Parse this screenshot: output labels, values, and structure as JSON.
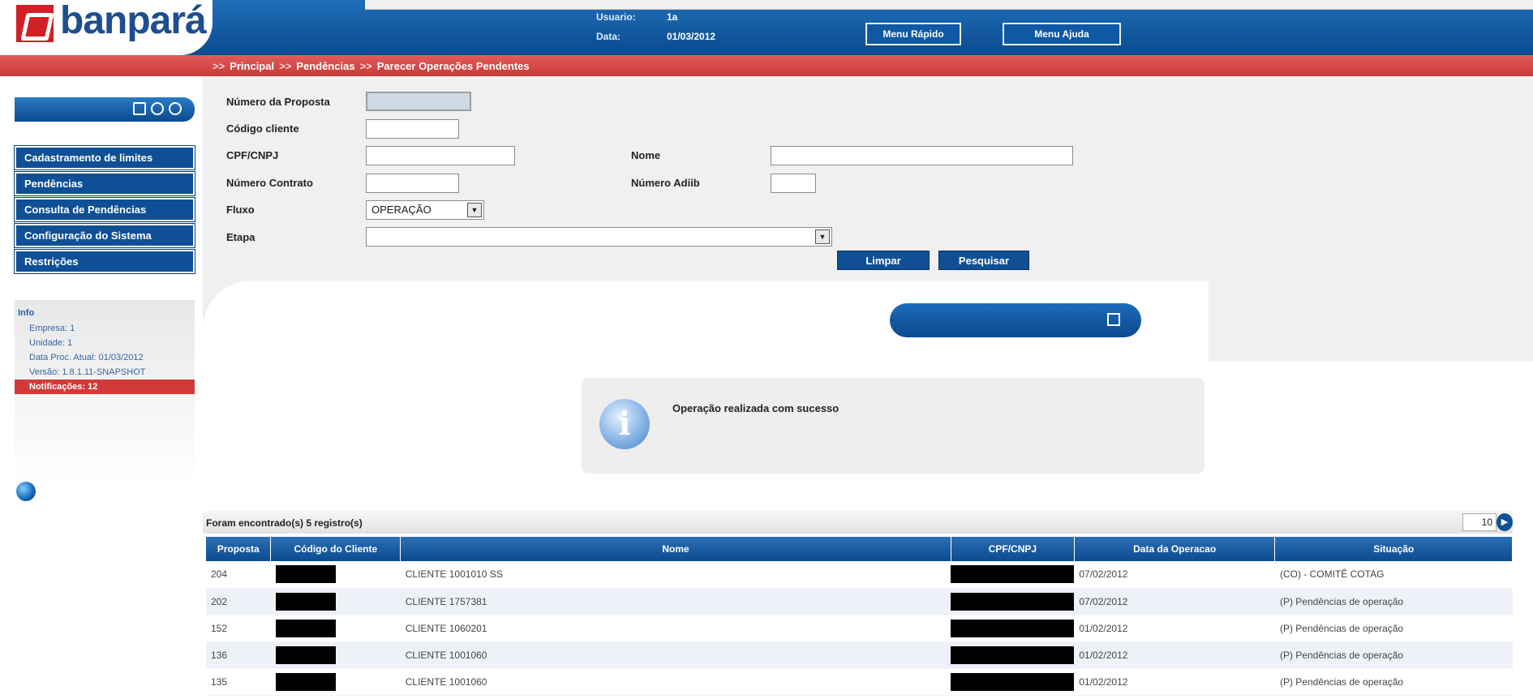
{
  "brand": {
    "name": "banpará",
    "accent": "#0b4a8f",
    "alert": "#d23a3a"
  },
  "header": {
    "user_label": "Usuario:",
    "user_value": "1a",
    "date_label": "Data:",
    "date_value": "01/03/2012",
    "buttons": [
      "Menu Rápido",
      "Menu Ajuda"
    ]
  },
  "breadcrumb": [
    "Principal",
    "Pendências",
    "Parecer Operações Pendentes"
  ],
  "breadcrumb_sep": ">>",
  "sidebar": {
    "toolbar_icons": [
      "notes-icon",
      "refresh-icon",
      "power-icon"
    ],
    "menu": [
      "Cadastramento de limites",
      "Pendências",
      "Consulta de Pendências",
      "Configuração do Sistema",
      "Restrições"
    ],
    "info_title": "Info",
    "info_lines": [
      "Empresa: 1",
      "Unidade: 1",
      "Data Proc. Atual: 01/03/2012",
      "Versão: 1.8.1.11-SNAPSHOT"
    ],
    "notifications": "Notificações: 12"
  },
  "form": {
    "proposta_label": "Número da Proposta",
    "codigo_label": "Código cliente",
    "cpf_label": "CPF/CNPJ",
    "nome_label": "Nome",
    "contrato_label": "Número Contrato",
    "adiib_label": "Número Adiib",
    "fluxo_label": "Fluxo",
    "fluxo_value": "OPERAÇÃO",
    "etapa_label": "Etapa",
    "etapa_value": "",
    "limpar": "Limpar",
    "pesquisar": "Pesquisar"
  },
  "message": {
    "text": "Operação realizada com sucesso"
  },
  "results": {
    "count_text": "Foram encontrado(s) 5 registro(s)",
    "page_size": "10",
    "columns": [
      "Proposta",
      "Código do Cliente",
      "Nome",
      "CPF/CNPJ",
      "Data da Operacao",
      "Situação"
    ],
    "rows": [
      {
        "proposta": "204",
        "nome": "CLIENTE 1001010 SS",
        "data": "07/02/2012",
        "situacao": "(CO) - COMITÊ COTAG"
      },
      {
        "proposta": "202",
        "nome": "CLIENTE 1757381",
        "data": "07/02/2012",
        "situacao": "(P) Pendências de operação"
      },
      {
        "proposta": "152",
        "nome": "CLIENTE 1060201",
        "data": "01/02/2012",
        "situacao": "(P) Pendências de operação"
      },
      {
        "proposta": "136",
        "nome": "CLIENTE 1001060",
        "data": "01/02/2012",
        "situacao": "(P) Pendências de operação"
      },
      {
        "proposta": "135",
        "nome": "CLIENTE 1001060",
        "data": "01/02/2012",
        "situacao": "(P) Pendências de operação"
      }
    ]
  }
}
